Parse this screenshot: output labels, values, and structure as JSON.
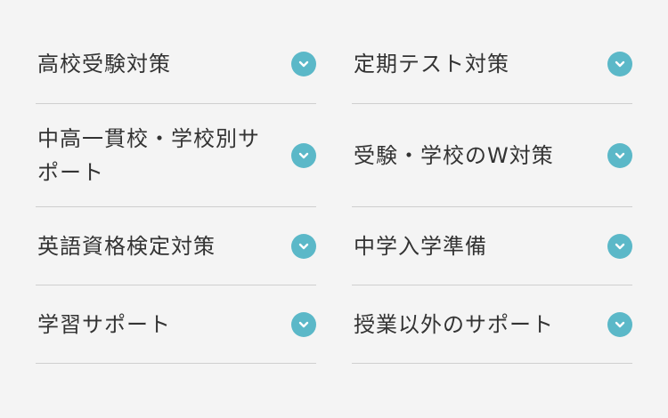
{
  "menu": {
    "items": [
      {
        "label": "高校受験対策",
        "icon": "chevron-down-icon"
      },
      {
        "label": "定期テスト対策",
        "icon": "chevron-down-icon"
      },
      {
        "label": "中高一貫校・学校別サポート",
        "icon": "chevron-down-icon"
      },
      {
        "label": "受験・学校のW対策",
        "icon": "chevron-down-icon"
      },
      {
        "label": "英語資格検定対策",
        "icon": "chevron-down-icon"
      },
      {
        "label": "中学入学準備",
        "icon": "chevron-down-icon"
      },
      {
        "label": "学習サポート",
        "icon": "chevron-down-icon"
      },
      {
        "label": "授業以外のサポート",
        "icon": "chevron-down-icon"
      }
    ]
  },
  "colors": {
    "background": "#f4f4f4",
    "text": "#333333",
    "accent": "#5bb8c8",
    "divider": "#cfcfcf"
  }
}
